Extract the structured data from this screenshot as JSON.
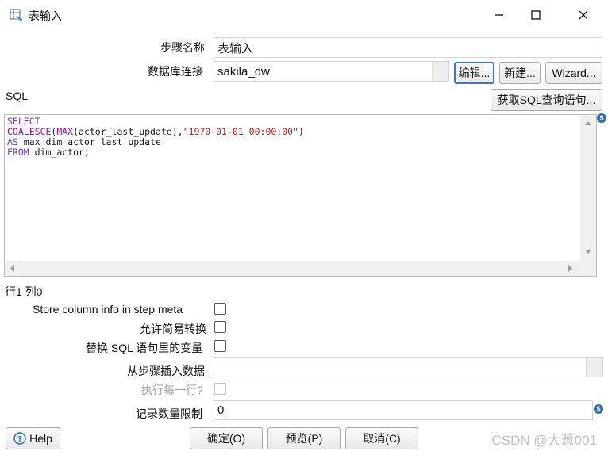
{
  "window": {
    "title": "表输入",
    "controls": {
      "minimize": "minimize-icon",
      "maximize": "maximize-icon",
      "close": "close-icon"
    }
  },
  "form": {
    "step_name_label": "步骤名称",
    "step_name_value": "表输入",
    "db_conn_label": "数据库连接",
    "db_conn_value": "sakila_dw",
    "edit_button": "编辑...",
    "new_button": "新建...",
    "wizard_button": "Wizard...",
    "sql_label": "SQL",
    "get_sql_button": "获取SQL查询语句...",
    "sql_lines": {
      "l1_kw": "SELECT",
      "l2_fn1": "COALESCE",
      "l2_p1": "(",
      "l2_fn2": "MAX",
      "l2_p2": "(actor_last_update),",
      "l2_str": "\"1970-01-01 00:00:00\"",
      "l2_p3": ")",
      "l3_kw": "AS",
      "l3_rest": " max_dim_actor_last_update",
      "l4_kw": "FROM",
      "l4_rest": " dim_actor;"
    },
    "position_status": "行1 列0",
    "store_column_info_label": "Store column info in step meta",
    "lazy_conversion_label": "允许简易转换",
    "replace_variables_label": "替换 SQL 语句里的变量",
    "insert_from_step_label": "从步骤插入数据",
    "insert_from_step_value": "",
    "execute_each_row_label": "执行每一行?",
    "limit_label": "记录数量限制",
    "limit_value": "0"
  },
  "checkboxes": {
    "store_column_info": false,
    "lazy_conversion": false,
    "replace_variables": false,
    "execute_each_row": false
  },
  "footer": {
    "help_button": "Help",
    "ok_button": "确定(O)",
    "preview_button": "预览(P)",
    "cancel_button": "取消(C)"
  },
  "watermark": "CSDN @大葱001",
  "colors": {
    "sql_keyword": "#6a3ccf",
    "sql_function": "#b000b0",
    "sql_string": "#c0141c",
    "focus_border": "#3b78c4",
    "variable_icon": "#2d6db0"
  }
}
